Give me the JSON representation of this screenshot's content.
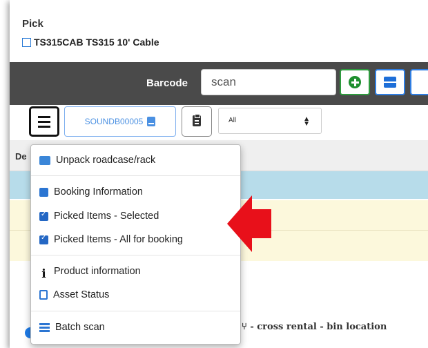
{
  "header": {
    "title": "Pick",
    "product": "TS315CAB TS315 10' Cable"
  },
  "barcode": {
    "label": "Barcode",
    "value": "scan"
  },
  "toolbar": {
    "booking_code": "SOUNDB00005",
    "filter_value": "All"
  },
  "table": {
    "header_fragment": "De"
  },
  "menu": {
    "items": [
      {
        "label": "Unpack roadcase/rack",
        "icon": "boxes-icon"
      },
      {
        "label": "Booking Information",
        "icon": "note-icon"
      },
      {
        "label": "Picked Items - Selected",
        "icon": "clipboard-check-icon"
      },
      {
        "label": "Picked Items - All for booking",
        "icon": "clipboard-check-icon"
      },
      {
        "label": "Product information",
        "icon": "info-icon"
      },
      {
        "label": "Asset Status",
        "icon": "file-icon"
      },
      {
        "label": "Batch scan",
        "icon": "list-icon"
      }
    ]
  },
  "legend": {
    "text": "- cross rental  - bin location"
  },
  "colors": {
    "arrow": "#e8101a",
    "accent": "#2f7de1",
    "selected_row": "#b7dcea",
    "picked_row": "#fcf8dc"
  }
}
